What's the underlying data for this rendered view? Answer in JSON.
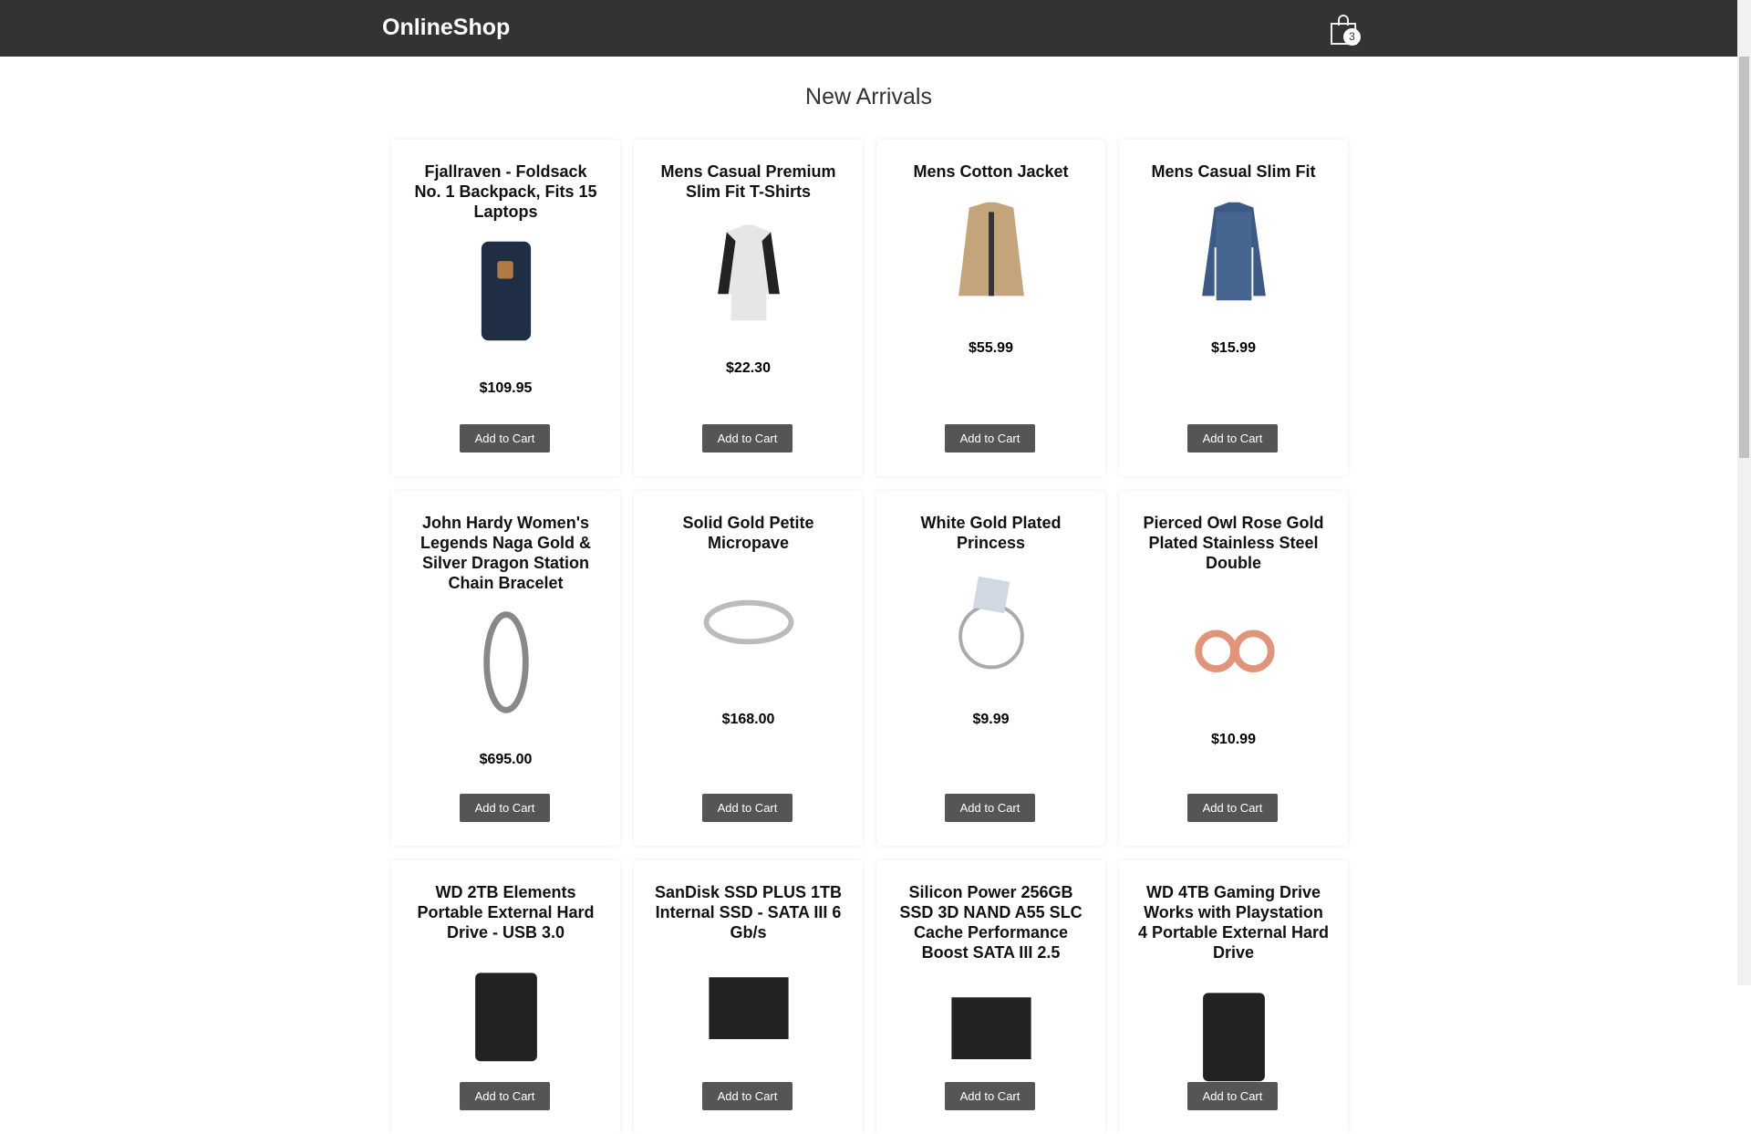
{
  "header": {
    "brand": "OnlineShop",
    "cart_count": "3"
  },
  "page_title": "New Arrivals",
  "add_label": "Add to Cart",
  "products": [
    {
      "title": "Fjallraven - Foldsack No. 1 Backpack, Fits 15 Laptops",
      "price": "$109.95",
      "icon": "backpack"
    },
    {
      "title": "Mens Casual Premium Slim Fit T-Shirts",
      "price": "$22.30",
      "icon": "tshirt"
    },
    {
      "title": "Mens Cotton Jacket",
      "price": "$55.99",
      "icon": "jacket"
    },
    {
      "title": "Mens Casual Slim Fit",
      "price": "$15.99",
      "icon": "longsleeve"
    },
    {
      "title": "John Hardy Women's Legends Naga Gold & Silver Dragon Station Chain Bracelet",
      "price": "$695.00",
      "icon": "bracelet"
    },
    {
      "title": "Solid Gold Petite Micropave",
      "price": "$168.00",
      "icon": "ring"
    },
    {
      "title": "White Gold Plated Princess",
      "price": "$9.99",
      "icon": "ring-set"
    },
    {
      "title": "Pierced Owl Rose Gold Plated Stainless Steel Double",
      "price": "$10.99",
      "icon": "plugs"
    },
    {
      "title": "WD 2TB Elements Portable External Hard Drive - USB 3.0",
      "price": "",
      "icon": "hard-drive"
    },
    {
      "title": "SanDisk SSD PLUS 1TB Internal SSD - SATA III 6 Gb/s",
      "price": "",
      "icon": "ssd"
    },
    {
      "title": "Silicon Power 256GB SSD 3D NAND A55 SLC Cache Performance Boost SATA III 2.5",
      "price": "",
      "icon": "ssd"
    },
    {
      "title": "WD 4TB Gaming Drive Works with Playstation 4 Portable External Hard Drive",
      "price": "",
      "icon": "hard-drive"
    }
  ]
}
